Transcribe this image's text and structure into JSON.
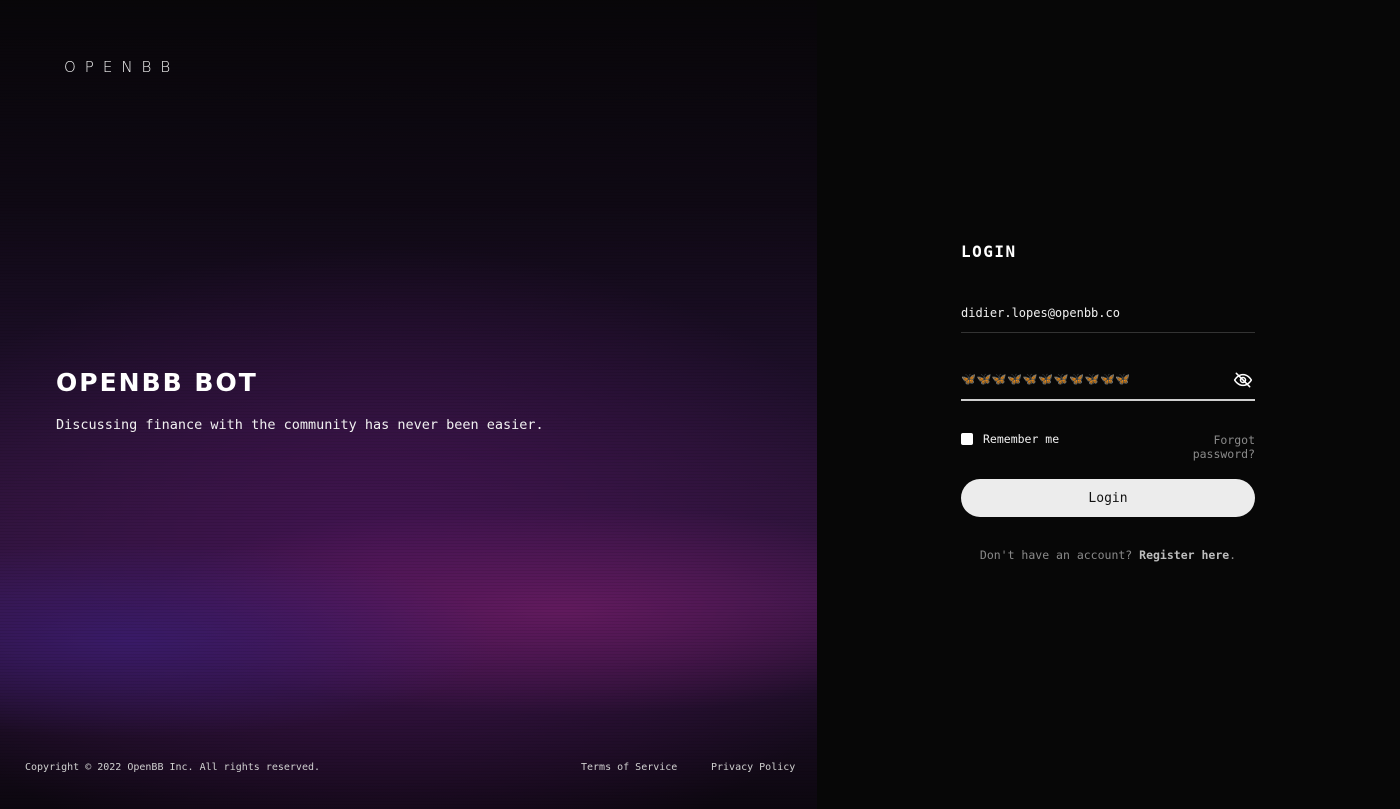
{
  "brand": {
    "logo_text": "OPENBB"
  },
  "hero": {
    "title": "OPENBB BOT",
    "subtitle": "Discussing finance with the community has never been easier."
  },
  "footer": {
    "copyright": "Copyright © 2022 OpenBB Inc. All rights reserved.",
    "terms_label": "Terms of Service",
    "privacy_label": "Privacy Policy"
  },
  "login_form": {
    "title": "LOGIN",
    "email_value": "didier.lopes@openbb.co",
    "password_mask": "🦋🦋🦋🦋🦋🦋🦋🦋🦋🦋🦋",
    "password_toggle_icon": "eye-off-icon",
    "remember_label": "Remember me",
    "remember_checked": false,
    "forgot_label": "Forgot password?",
    "submit_label": "Login",
    "register_prompt": "Don't have an account?",
    "register_link": "Register here",
    "register_suffix": "."
  },
  "colors": {
    "left_panel_accent": "#2f1540",
    "right_panel_bg": "#070707",
    "button_bg": "#ececec",
    "muted_text": "#8a8a8a"
  }
}
